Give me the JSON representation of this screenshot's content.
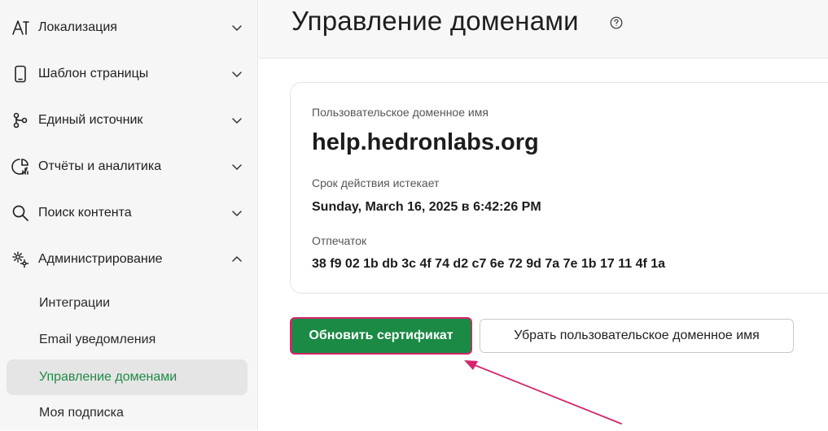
{
  "sidebar": {
    "items": [
      {
        "label": "Локализация",
        "icon": "text-size-icon",
        "expanded": false
      },
      {
        "label": "Шаблон страницы",
        "icon": "phone-icon",
        "expanded": false
      },
      {
        "label": "Единый источник",
        "icon": "branch-icon",
        "expanded": false
      },
      {
        "label": "Отчёты и аналитика",
        "icon": "chart-icon",
        "expanded": false
      },
      {
        "label": "Поиск контента",
        "icon": "search-icon",
        "expanded": false
      },
      {
        "label": "Администрирование",
        "icon": "gear-icon",
        "expanded": true
      }
    ],
    "sub_items": [
      {
        "label": "Интеграции",
        "active": false
      },
      {
        "label": "Email уведомления",
        "active": false
      },
      {
        "label": "Управление доменами",
        "active": true
      },
      {
        "label": "Моя подписка",
        "active": false
      }
    ]
  },
  "header": {
    "title": "Управление доменами",
    "help_icon": "question-circle-icon"
  },
  "card": {
    "domain_label": "Пользовательское доменное имя",
    "domain_value": "help.hedronlabs.org",
    "expiry_label": "Срок действия истекает",
    "expiry_value": "Sunday, March 16, 2025 в 6:42:26 PM",
    "fingerprint_label": "Отпечаток",
    "fingerprint_value": "38 f9 02 1b db 3c 4f 74 d2 c7 6e 72 9d 7a 7e 1b 17 11 4f 1a"
  },
  "actions": {
    "renew_label": "Обновить сертификат",
    "remove_label": "Убрать пользовательское доменное имя"
  },
  "colors": {
    "accent_green": "#1b8a44",
    "highlight_pink": "#d6246d",
    "active_text": "#1e8a45"
  }
}
